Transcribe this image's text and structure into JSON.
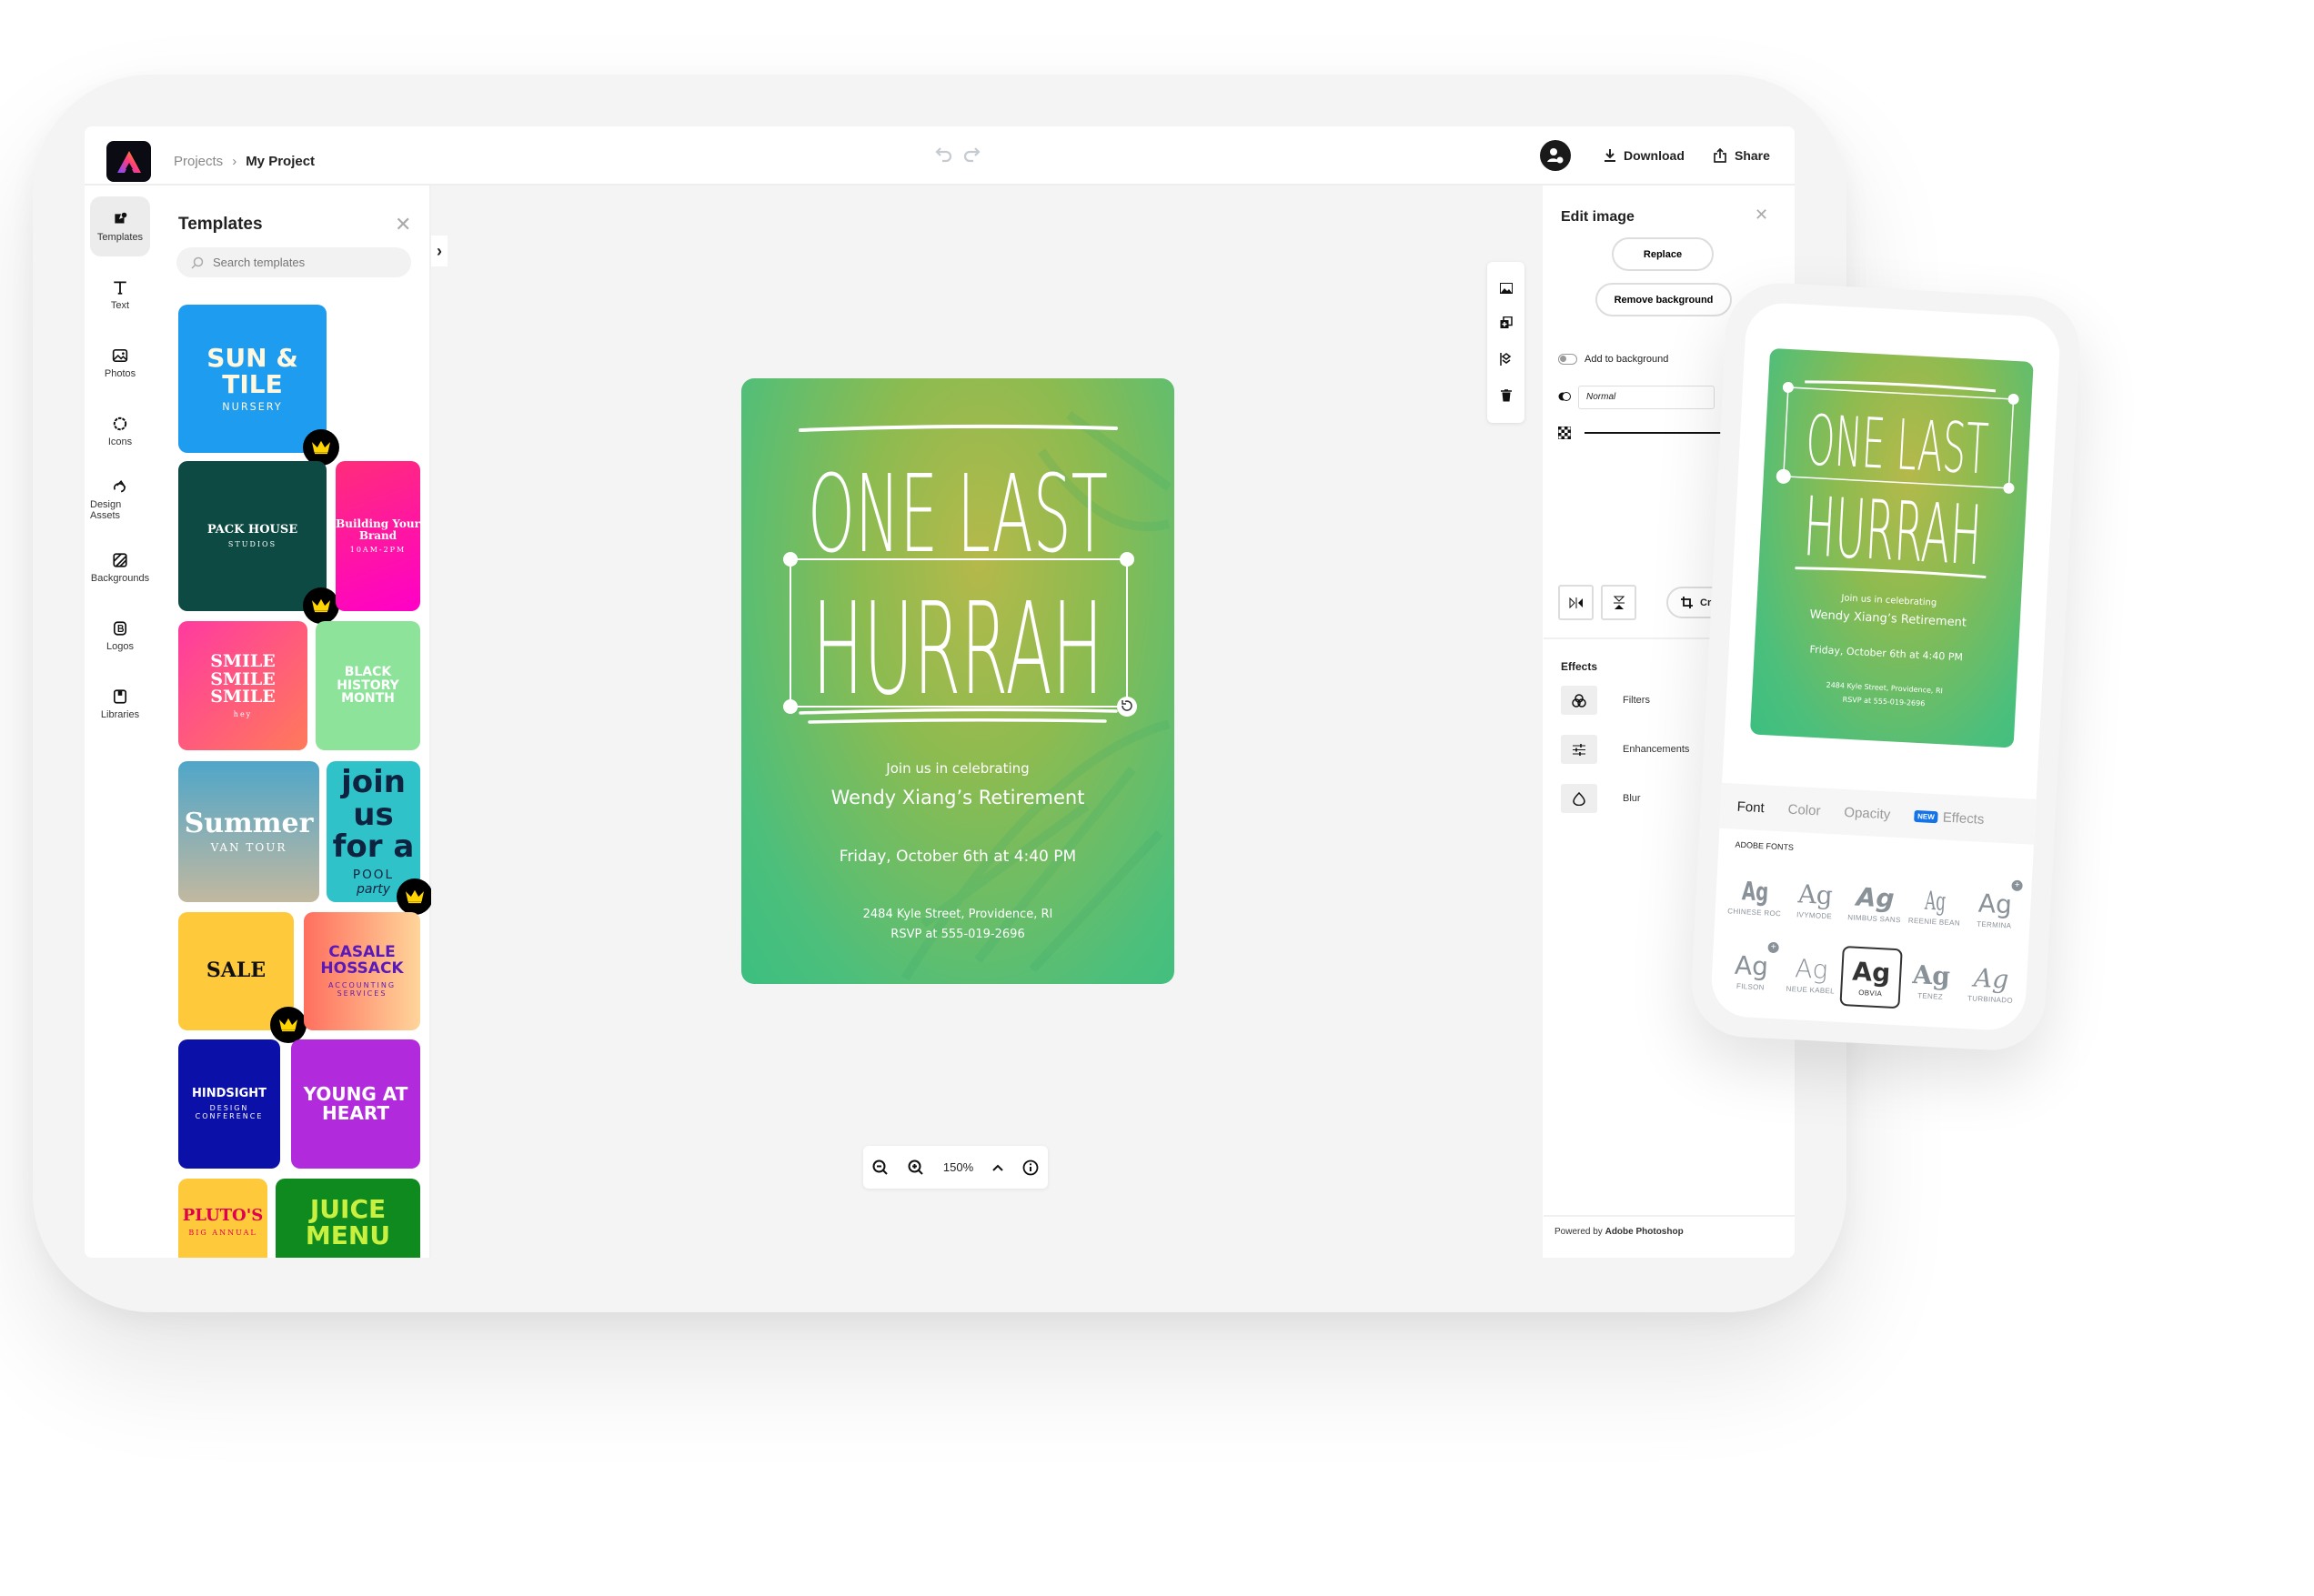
{
  "header": {
    "breadcrumb": [
      "Projects",
      "My Project"
    ],
    "download": "Download",
    "share": "Share"
  },
  "rail": {
    "items": [
      {
        "label": "Templates",
        "icon": "templates-icon",
        "active": true
      },
      {
        "label": "Text",
        "icon": "text-icon"
      },
      {
        "label": "Photos",
        "icon": "photos-icon"
      },
      {
        "label": "Icons",
        "icon": "icons-icon"
      },
      {
        "label": "Design Assets",
        "icon": "design-assets-icon"
      },
      {
        "label": "Backgrounds",
        "icon": "backgrounds-icon"
      },
      {
        "label": "Logos",
        "icon": "logos-icon"
      },
      {
        "label": "Libraries",
        "icon": "libraries-icon"
      }
    ]
  },
  "templates": {
    "title": "Templates",
    "search_placeholder": "Search templates",
    "items": [
      {
        "line1": "SUN & TILE",
        "line2": "NURSERY",
        "premium": true
      },
      {
        "line1": "PACK HOUSE",
        "line2": "STUDIOS",
        "premium": true
      },
      {
        "line1": "Building Your Brand",
        "line2": "10AM-2PM",
        "premium": false
      },
      {
        "line1": "SMILE SMILE SMILE",
        "line2": "hey",
        "premium": false
      },
      {
        "line1": "BLACK HISTORY MONTH",
        "premium": false
      },
      {
        "line1": "Summer",
        "line2": "VAN TOUR",
        "premium": false
      },
      {
        "line1": "join us for a",
        "line2": "POOL",
        "line3": "party",
        "premium": true
      },
      {
        "line1": "SALE",
        "premium": true
      },
      {
        "line1": "CASALE HOSSACK",
        "line2": "ACCOUNTING SERVICES",
        "premium": false
      },
      {
        "line1": "HINDSIGHT",
        "line2": "DESIGN CONFERENCE",
        "premium": false
      },
      {
        "line1": "YOUNG AT HEART",
        "premium": false
      },
      {
        "line1": "PLUTO'S",
        "line2": "BIG ANNUAL",
        "premium": false
      },
      {
        "line1": "JUICE MENU",
        "premium": false
      }
    ]
  },
  "design": {
    "title_line1": "ONE LAST",
    "title_line2": "HURRAH",
    "intro": "Join us in celebrating",
    "event": "Wendy Xiang’s Retirement",
    "datetime": "Friday, October 6th at 4:40 PM",
    "address": "2484 Kyle Street, Providence, RI",
    "rsvp": "RSVP at 555-019-2696"
  },
  "zoom": {
    "level": "150%"
  },
  "edit_panel": {
    "title": "Edit image",
    "replace": "Replace",
    "remove_background": "Remove background",
    "add_to_background": "Add to background",
    "add_to_background_on": false,
    "blend_mode": "Normal",
    "crop": "Crop",
    "effects_title": "Effects",
    "effects": [
      "Filters",
      "Enhancements",
      "Blur"
    ],
    "powered_by": "Powered by",
    "powered_brand": "Adobe Photoshop"
  },
  "phone": {
    "tabs": [
      "Font",
      "Color",
      "Opacity",
      "Effects"
    ],
    "active_tab": "Font",
    "new_badge": "NEW",
    "section": "ADOBE FONTS",
    "fonts": [
      {
        "name": "CHINESE ROC"
      },
      {
        "name": "IVYMODE"
      },
      {
        "name": "NIMBUS SANS"
      },
      {
        "name": "REENIE BEAN"
      },
      {
        "name": "TERMINA",
        "add": true
      },
      {
        "name": "FILSON",
        "add": true
      },
      {
        "name": "NEUE KABEL"
      },
      {
        "name": "OBVIA",
        "selected": true
      },
      {
        "name": "TENEZ"
      },
      {
        "name": "TURBINADO"
      }
    ],
    "sample": "Ag"
  },
  "colors": {
    "accent": "#1473e6",
    "card_green": "#4cbf7c",
    "card_yellow": "#b5b94a"
  }
}
